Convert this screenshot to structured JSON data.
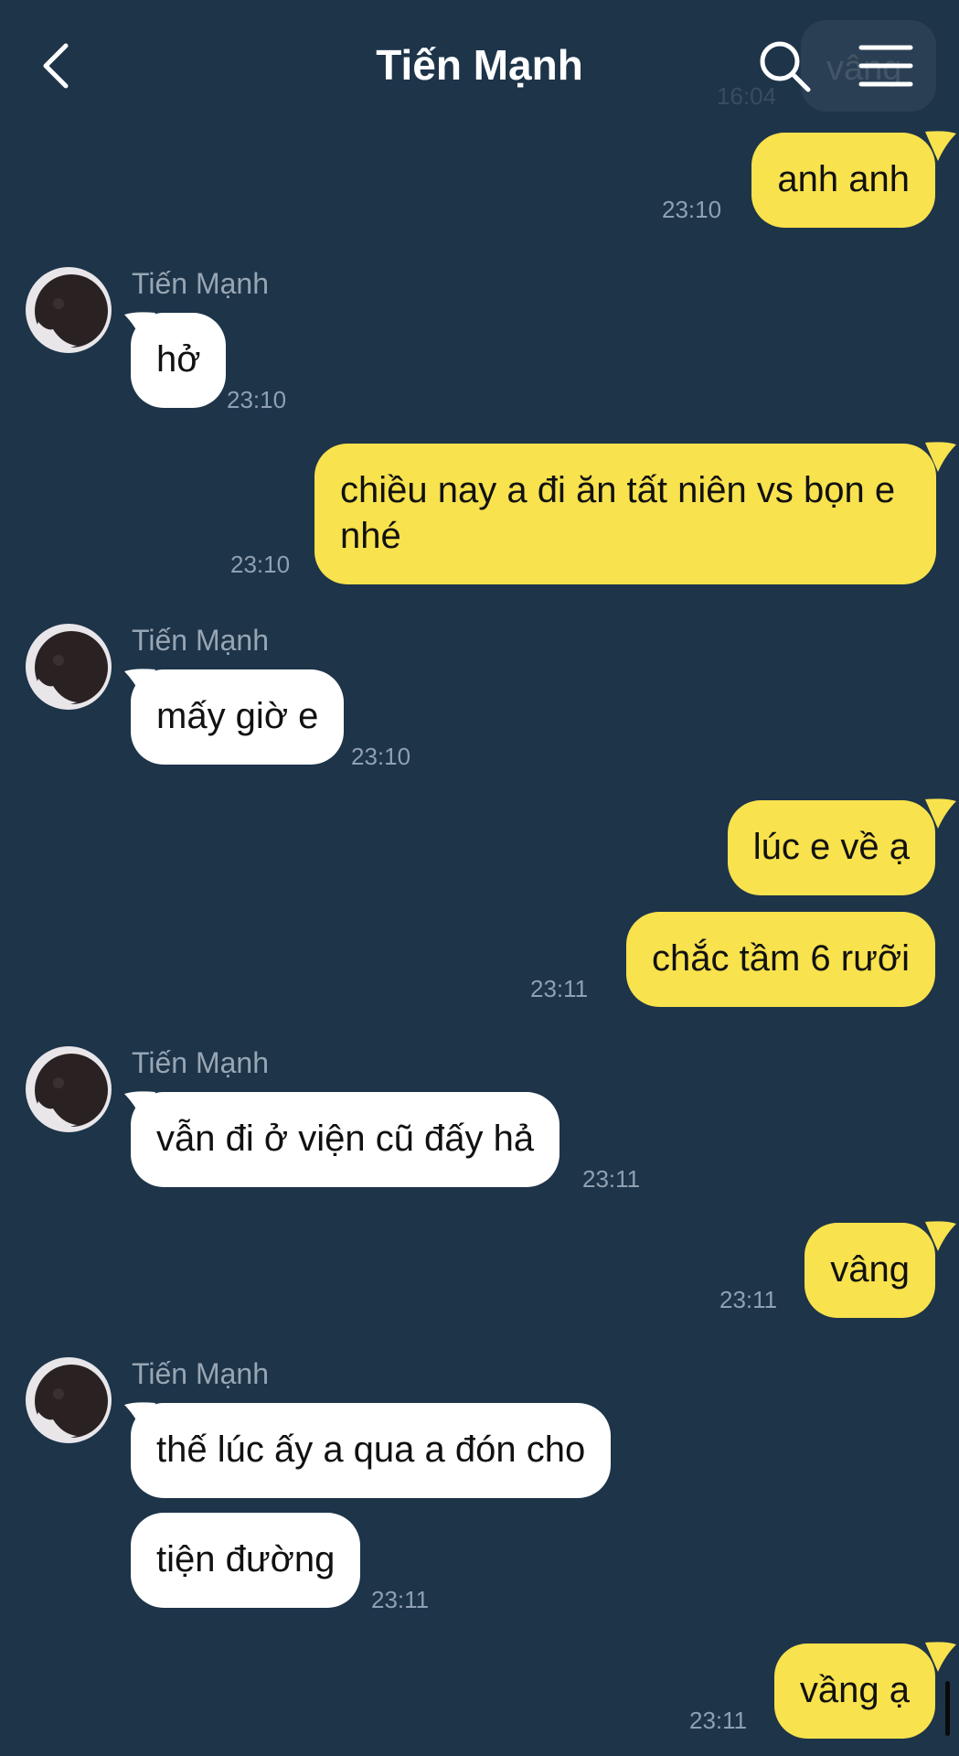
{
  "header": {
    "title": "Tiến Mạnh",
    "back_icon": "chevron-left-icon",
    "search_icon": "search-icon",
    "menu_icon": "menu-icon"
  },
  "ghost": {
    "text": "vâng",
    "time": "16:04"
  },
  "colors": {
    "background": "#1d3449",
    "outgoing_bubble": "#f8e24d",
    "incoming_bubble": "#ffffff"
  },
  "messages": [
    {
      "dir": "out",
      "text": "anh anh",
      "time": "23:10"
    },
    {
      "dir": "in",
      "sender": "Tiến Mạnh",
      "text": "hở",
      "time": "23:10"
    },
    {
      "dir": "out",
      "text": "chiều nay a đi ăn tất niên vs bọn e nhé",
      "time": "23:10"
    },
    {
      "dir": "in",
      "sender": "Tiến Mạnh",
      "text": "mấy giờ e",
      "time": "23:10"
    },
    {
      "dir": "out",
      "text": "lúc e về ạ"
    },
    {
      "dir": "out",
      "text": "chắc tầm 6 rưỡi",
      "time": "23:11"
    },
    {
      "dir": "in",
      "sender": "Tiến Mạnh",
      "text": "vẫn đi ở viện cũ đấy hả",
      "time": "23:11"
    },
    {
      "dir": "out",
      "text": "vâng",
      "time": "23:11"
    },
    {
      "dir": "in",
      "sender": "Tiến Mạnh",
      "text": "thế lúc ấy a qua a đón cho"
    },
    {
      "dir": "in",
      "text": "tiện đường",
      "time": "23:11"
    },
    {
      "dir": "out",
      "text": "vầng ạ",
      "time": "23:11"
    }
  ]
}
